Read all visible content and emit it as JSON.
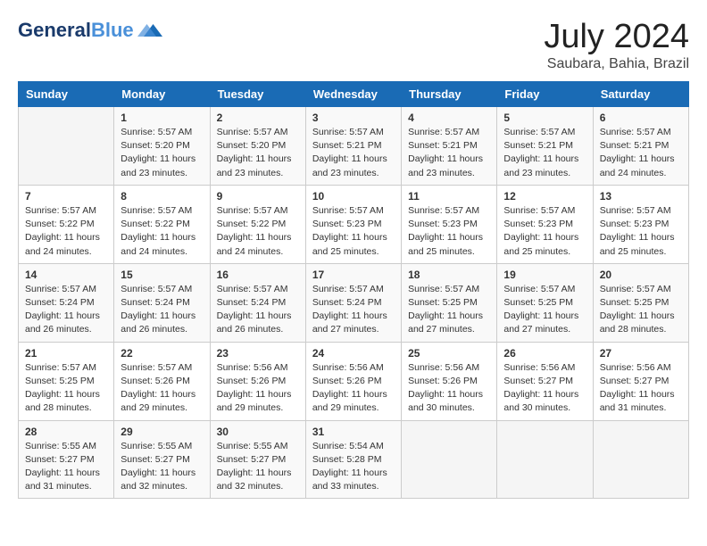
{
  "header": {
    "logo_line1": "General",
    "logo_line2": "Blue",
    "month_year": "July 2024",
    "location": "Saubara, Bahia, Brazil"
  },
  "days_of_week": [
    "Sunday",
    "Monday",
    "Tuesday",
    "Wednesday",
    "Thursday",
    "Friday",
    "Saturday"
  ],
  "weeks": [
    [
      {
        "day": "",
        "content": ""
      },
      {
        "day": "1",
        "content": "Sunrise: 5:57 AM\nSunset: 5:20 PM\nDaylight: 11 hours\nand 23 minutes."
      },
      {
        "day": "2",
        "content": "Sunrise: 5:57 AM\nSunset: 5:20 PM\nDaylight: 11 hours\nand 23 minutes."
      },
      {
        "day": "3",
        "content": "Sunrise: 5:57 AM\nSunset: 5:21 PM\nDaylight: 11 hours\nand 23 minutes."
      },
      {
        "day": "4",
        "content": "Sunrise: 5:57 AM\nSunset: 5:21 PM\nDaylight: 11 hours\nand 23 minutes."
      },
      {
        "day": "5",
        "content": "Sunrise: 5:57 AM\nSunset: 5:21 PM\nDaylight: 11 hours\nand 23 minutes."
      },
      {
        "day": "6",
        "content": "Sunrise: 5:57 AM\nSunset: 5:21 PM\nDaylight: 11 hours\nand 24 minutes."
      }
    ],
    [
      {
        "day": "7",
        "content": "Sunrise: 5:57 AM\nSunset: 5:22 PM\nDaylight: 11 hours\nand 24 minutes."
      },
      {
        "day": "8",
        "content": "Sunrise: 5:57 AM\nSunset: 5:22 PM\nDaylight: 11 hours\nand 24 minutes."
      },
      {
        "day": "9",
        "content": "Sunrise: 5:57 AM\nSunset: 5:22 PM\nDaylight: 11 hours\nand 24 minutes."
      },
      {
        "day": "10",
        "content": "Sunrise: 5:57 AM\nSunset: 5:23 PM\nDaylight: 11 hours\nand 25 minutes."
      },
      {
        "day": "11",
        "content": "Sunrise: 5:57 AM\nSunset: 5:23 PM\nDaylight: 11 hours\nand 25 minutes."
      },
      {
        "day": "12",
        "content": "Sunrise: 5:57 AM\nSunset: 5:23 PM\nDaylight: 11 hours\nand 25 minutes."
      },
      {
        "day": "13",
        "content": "Sunrise: 5:57 AM\nSunset: 5:23 PM\nDaylight: 11 hours\nand 25 minutes."
      }
    ],
    [
      {
        "day": "14",
        "content": "Sunrise: 5:57 AM\nSunset: 5:24 PM\nDaylight: 11 hours\nand 26 minutes."
      },
      {
        "day": "15",
        "content": "Sunrise: 5:57 AM\nSunset: 5:24 PM\nDaylight: 11 hours\nand 26 minutes."
      },
      {
        "day": "16",
        "content": "Sunrise: 5:57 AM\nSunset: 5:24 PM\nDaylight: 11 hours\nand 26 minutes."
      },
      {
        "day": "17",
        "content": "Sunrise: 5:57 AM\nSunset: 5:24 PM\nDaylight: 11 hours\nand 27 minutes."
      },
      {
        "day": "18",
        "content": "Sunrise: 5:57 AM\nSunset: 5:25 PM\nDaylight: 11 hours\nand 27 minutes."
      },
      {
        "day": "19",
        "content": "Sunrise: 5:57 AM\nSunset: 5:25 PM\nDaylight: 11 hours\nand 27 minutes."
      },
      {
        "day": "20",
        "content": "Sunrise: 5:57 AM\nSunset: 5:25 PM\nDaylight: 11 hours\nand 28 minutes."
      }
    ],
    [
      {
        "day": "21",
        "content": "Sunrise: 5:57 AM\nSunset: 5:25 PM\nDaylight: 11 hours\nand 28 minutes."
      },
      {
        "day": "22",
        "content": "Sunrise: 5:57 AM\nSunset: 5:26 PM\nDaylight: 11 hours\nand 29 minutes."
      },
      {
        "day": "23",
        "content": "Sunrise: 5:56 AM\nSunset: 5:26 PM\nDaylight: 11 hours\nand 29 minutes."
      },
      {
        "day": "24",
        "content": "Sunrise: 5:56 AM\nSunset: 5:26 PM\nDaylight: 11 hours\nand 29 minutes."
      },
      {
        "day": "25",
        "content": "Sunrise: 5:56 AM\nSunset: 5:26 PM\nDaylight: 11 hours\nand 30 minutes."
      },
      {
        "day": "26",
        "content": "Sunrise: 5:56 AM\nSunset: 5:27 PM\nDaylight: 11 hours\nand 30 minutes."
      },
      {
        "day": "27",
        "content": "Sunrise: 5:56 AM\nSunset: 5:27 PM\nDaylight: 11 hours\nand 31 minutes."
      }
    ],
    [
      {
        "day": "28",
        "content": "Sunrise: 5:55 AM\nSunset: 5:27 PM\nDaylight: 11 hours\nand 31 minutes."
      },
      {
        "day": "29",
        "content": "Sunrise: 5:55 AM\nSunset: 5:27 PM\nDaylight: 11 hours\nand 32 minutes."
      },
      {
        "day": "30",
        "content": "Sunrise: 5:55 AM\nSunset: 5:27 PM\nDaylight: 11 hours\nand 32 minutes."
      },
      {
        "day": "31",
        "content": "Sunrise: 5:54 AM\nSunset: 5:28 PM\nDaylight: 11 hours\nand 33 minutes."
      },
      {
        "day": "",
        "content": ""
      },
      {
        "day": "",
        "content": ""
      },
      {
        "day": "",
        "content": ""
      }
    ]
  ]
}
